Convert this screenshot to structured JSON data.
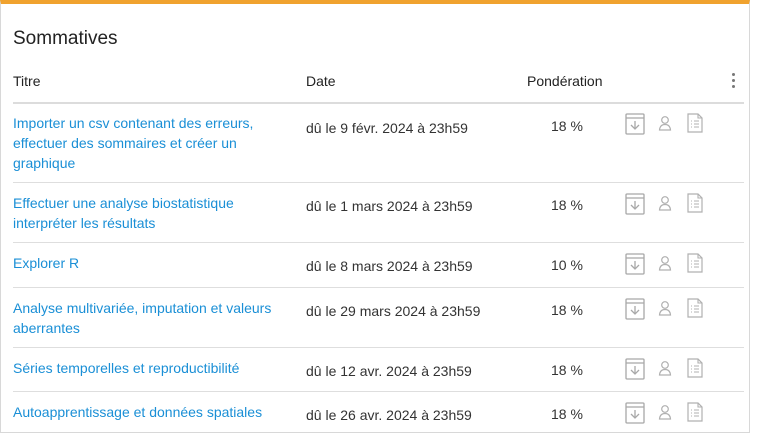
{
  "section": {
    "title": "Sommatives"
  },
  "columns": {
    "title": "Titre",
    "date": "Date",
    "weight": "Pondération"
  },
  "icons": {
    "download": "download-box-icon",
    "user": "user-icon",
    "document": "document-checklist-icon",
    "menu": "kebab-menu-icon"
  },
  "colors": {
    "accent": "#f0a22e",
    "link": "#1a8fd6",
    "icon": "#a8a8a8"
  },
  "rows": [
    {
      "title": "Importer un csv contenant des erreurs, effectuer des sommaires et créer un graphique",
      "date": "dû le 9 févr. 2024 à 23h59",
      "weight": "18 %"
    },
    {
      "title": "Effectuer une analyse biostatistique interpréter les résultats",
      "date": "dû le 1 mars 2024 à 23h59",
      "weight": "18 %"
    },
    {
      "title": "Explorer R",
      "date": "dû le 8 mars 2024 à 23h59",
      "weight": "10 %"
    },
    {
      "title": "Analyse multivariée, imputation et valeurs aberrantes",
      "date": "dû le 29 mars 2024 à 23h59",
      "weight": "18 %"
    },
    {
      "title": "Séries temporelles et reproductibilité",
      "date": "dû le 12 avr. 2024 à 23h59",
      "weight": "18 %"
    },
    {
      "title": "Autoapprentissage et données spatiales",
      "date": "dû le 26 avr. 2024 à 23h59",
      "weight": "18 %"
    }
  ]
}
